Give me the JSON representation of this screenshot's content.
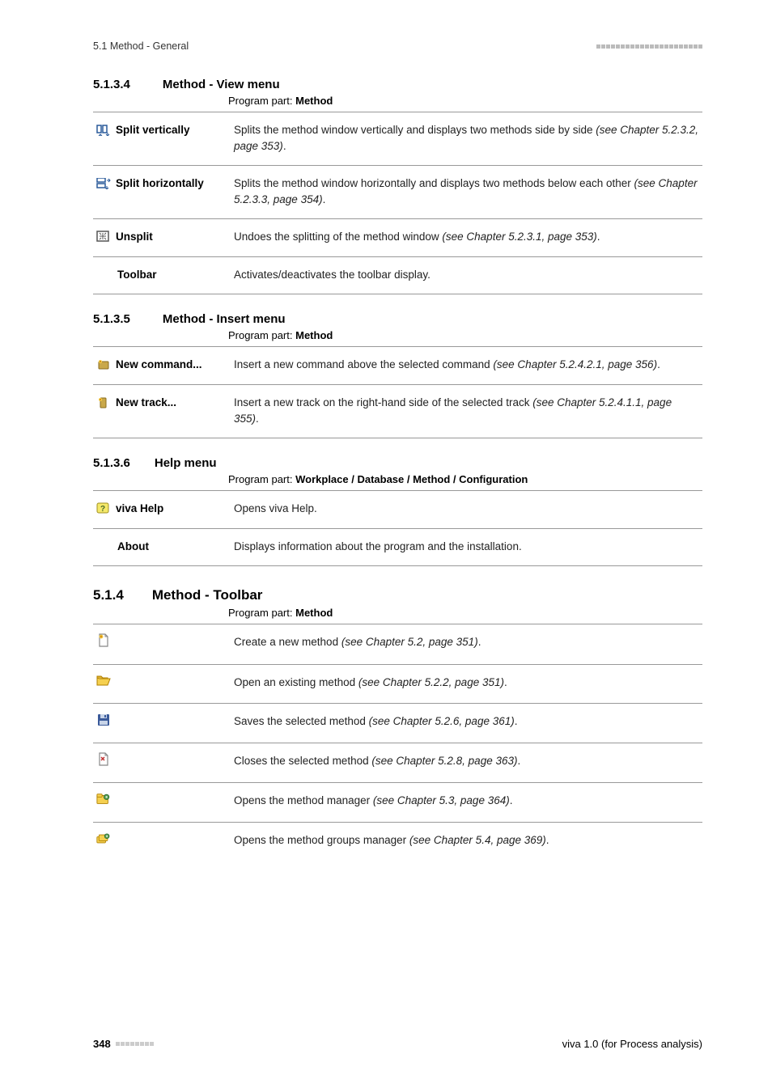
{
  "header": {
    "section_path": "5.1 Method - General"
  },
  "sec_5134": {
    "num": "5.1.3.4",
    "title": "Method - View menu",
    "program_part_label": "Program part:",
    "program_part_value": "Method",
    "rows": [
      {
        "label": "Split vertically",
        "desc_pre": "Splits the method window vertically and displays two methods side by side ",
        "desc_italic": "(see Chapter 5.2.3.2, page 353)",
        "desc_post": "."
      },
      {
        "label": "Split horizontally",
        "desc_pre": "Splits the method window horizontally and displays two methods below each other ",
        "desc_italic": "(see Chapter 5.2.3.3, page 354)",
        "desc_post": "."
      },
      {
        "label": "Unsplit",
        "desc_pre": "Undoes the splitting of the method window ",
        "desc_italic": "(see Chapter 5.2.3.1, page 353)",
        "desc_post": "."
      },
      {
        "label": "Toolbar",
        "desc_pre": "Activates/deactivates the toolbar display.",
        "desc_italic": "",
        "desc_post": ""
      }
    ]
  },
  "sec_5135": {
    "num": "5.1.3.5",
    "title": "Method - Insert menu",
    "program_part_label": "Program part:",
    "program_part_value": "Method",
    "rows": [
      {
        "label": "New command...",
        "desc_pre": "Insert a new command above the selected command ",
        "desc_italic": "(see Chapter 5.2.4.2.1, page 356)",
        "desc_post": "."
      },
      {
        "label": "New track...",
        "desc_pre": "Insert a new track on the right-hand side of the selected track ",
        "desc_italic": "(see Chapter 5.2.4.1.1, page 355)",
        "desc_post": "."
      }
    ]
  },
  "sec_5136": {
    "num": "5.1.3.6",
    "title": "Help menu",
    "program_part_label": "Program part:",
    "program_part_value": "Workplace / Database / Method / Configuration",
    "rows": [
      {
        "label": "viva Help",
        "desc_pre": "Opens viva Help.",
        "desc_italic": "",
        "desc_post": ""
      },
      {
        "label": "About",
        "desc_pre": "Displays information about the program and the installation.",
        "desc_italic": "",
        "desc_post": ""
      }
    ]
  },
  "sec_514": {
    "num": "5.1.4",
    "title": "Method - Toolbar",
    "program_part_label": "Program part:",
    "program_part_value": "Method",
    "rows": [
      {
        "desc_pre": "Create a new method ",
        "desc_italic": "(see Chapter 5.2, page 351)",
        "desc_post": "."
      },
      {
        "desc_pre": "Open an existing method ",
        "desc_italic": "(see Chapter 5.2.2, page 351)",
        "desc_post": "."
      },
      {
        "desc_pre": "Saves the selected method ",
        "desc_italic": "(see Chapter 5.2.6, page 361)",
        "desc_post": "."
      },
      {
        "desc_pre": "Closes the selected method ",
        "desc_italic": "(see Chapter 5.2.8, page 363)",
        "desc_post": "."
      },
      {
        "desc_pre": "Opens the method manager ",
        "desc_italic": "(see Chapter 5.3, page 364)",
        "desc_post": "."
      },
      {
        "desc_pre": "Opens the method groups manager ",
        "desc_italic": "(see Chapter 5.4, page 369)",
        "desc_post": "."
      }
    ]
  },
  "footer": {
    "page_number": "348",
    "product": "viva 1.0 (for Process analysis)"
  }
}
